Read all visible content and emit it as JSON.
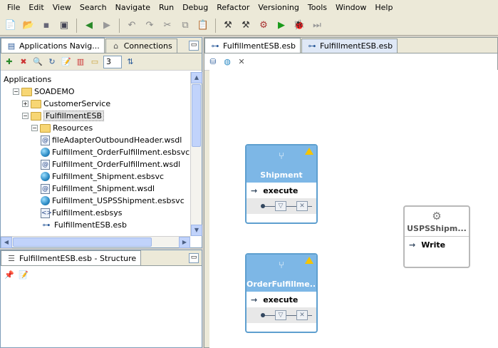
{
  "menu": [
    "File",
    "Edit",
    "View",
    "Search",
    "Navigate",
    "Run",
    "Debug",
    "Refactor",
    "Versioning",
    "Tools",
    "Window",
    "Help"
  ],
  "nav_tabs": [
    "Applications Navig...",
    "Connections"
  ],
  "nav_spinner": "3",
  "tree": [
    {
      "label": "Applications",
      "depth": 0,
      "kind": "root"
    },
    {
      "label": "SOADEMO",
      "depth": 1,
      "kind": "workspace",
      "exp": "−"
    },
    {
      "label": "CustomerService",
      "depth": 2,
      "kind": "folder",
      "exp": "+"
    },
    {
      "label": "FulfillmentESB",
      "depth": 2,
      "kind": "folder",
      "exp": "−"
    },
    {
      "label": "Resources",
      "depth": 3,
      "kind": "folder",
      "exp": "−"
    },
    {
      "label": "fileAdapterOutboundHeader.wsdl",
      "depth": 4,
      "kind": "wsdl"
    },
    {
      "label": "Fulfillment_OrderFulfillment.esbsvc",
      "depth": 4,
      "kind": "esbsvc"
    },
    {
      "label": "Fulfillment_OrderFulfillment.wsdl",
      "depth": 4,
      "kind": "wsdl"
    },
    {
      "label": "Fulfillment_Shipment.esbsvc",
      "depth": 4,
      "kind": "esbsvc"
    },
    {
      "label": "Fulfillment_Shipment.wsdl",
      "depth": 4,
      "kind": "wsdl"
    },
    {
      "label": "Fulfillment_USPSShipment.esbsvc",
      "depth": 4,
      "kind": "esbsvc"
    },
    {
      "label": "Fulfillment.esbsys",
      "depth": 4,
      "kind": "esbsys"
    },
    {
      "label": "FulfillmentESB.esb",
      "depth": 4,
      "kind": "esb"
    }
  ],
  "structure_title": "FulfillmentESB.esb - Structure",
  "editor_tabs": [
    "FulfillmentESB.esb",
    "FulfillmentESB.esb"
  ],
  "services": [
    {
      "title": "Shipment",
      "operation": "execute"
    },
    {
      "title": "OrderFulfillme...",
      "operation": "execute"
    }
  ],
  "adapter": {
    "title": "USPSShipm...",
    "operation": "Write"
  }
}
